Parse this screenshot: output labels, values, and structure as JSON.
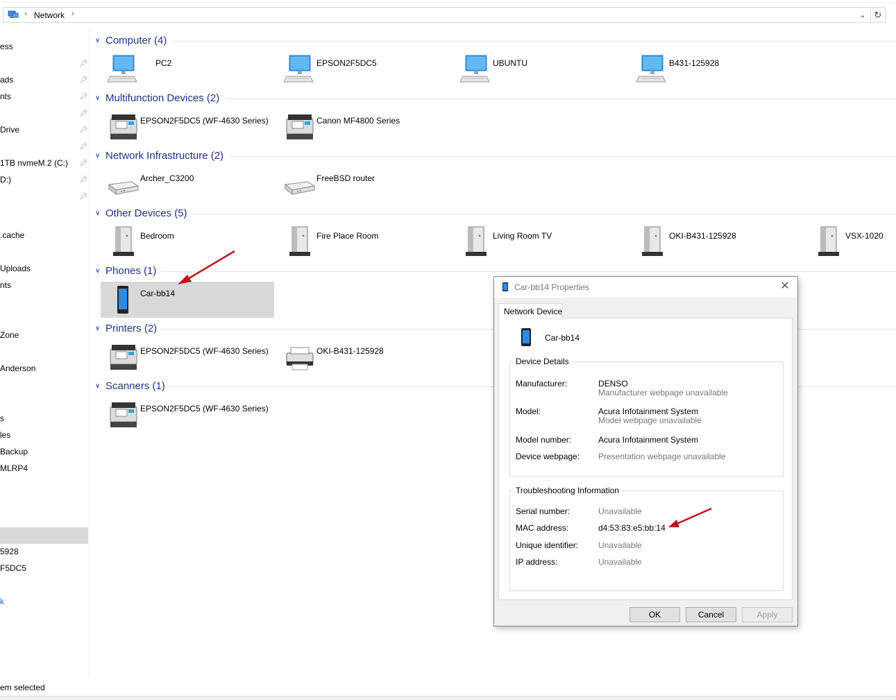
{
  "address_bar": {
    "crumbs": [
      "Network"
    ]
  },
  "nav": {
    "items": [
      {
        "label": "ess"
      },
      {
        "label": "ads"
      },
      {
        "label": "nts"
      },
      {
        "label": "Drive"
      },
      {
        "label": "1TB nvmeM.2 (C:)"
      },
      {
        "label": "D:)"
      },
      {
        "label": ".cache"
      },
      {
        "label": "Uploads"
      },
      {
        "label": "nts"
      },
      {
        "label": "Zone"
      },
      {
        "label": "Anderson"
      },
      {
        "label": "s"
      },
      {
        "label": "les"
      },
      {
        "label": "Backup"
      },
      {
        "label": "MLRP4"
      },
      {
        "label": ""
      },
      {
        "label": "5928"
      },
      {
        "label": "F5DC5"
      },
      {
        "label": "k"
      }
    ]
  },
  "groups": [
    {
      "title": "Computer (4)",
      "items": [
        {
          "label": "PC2",
          "icon": "computer-icon"
        },
        {
          "label": "EPSON2F5DC5",
          "icon": "computer-icon"
        },
        {
          "label": "UBUNTU",
          "icon": "computer-icon"
        },
        {
          "label": "B431-125928",
          "icon": "computer-icon"
        }
      ]
    },
    {
      "title": "Multifunction Devices (2)",
      "items": [
        {
          "label": "EPSON2F5DC5 (WF-4630 Series)",
          "icon": "multifunction-printer-icon"
        },
        {
          "label": "Canon MF4800 Series",
          "icon": "multifunction-printer-icon"
        }
      ]
    },
    {
      "title": "Network Infrastructure (2)",
      "items": [
        {
          "label": "Archer_C3200",
          "icon": "router-icon"
        },
        {
          "label": "FreeBSD router",
          "icon": "router-icon"
        }
      ]
    },
    {
      "title": "Other Devices (5)",
      "items": [
        {
          "label": "Bedroom",
          "icon": "media-device-icon"
        },
        {
          "label": "Fire Place Room",
          "icon": "media-device-icon"
        },
        {
          "label": "Living Room TV",
          "icon": "media-device-icon"
        },
        {
          "label": "OKI-B431-125928",
          "icon": "media-device-icon"
        },
        {
          "label": "VSX-1020",
          "icon": "media-device-icon"
        }
      ]
    },
    {
      "title": "Phones (1)",
      "items": [
        {
          "label": "Car-bb14",
          "icon": "phone-icon",
          "selected": true
        }
      ]
    },
    {
      "title": "Printers (2)",
      "items": [
        {
          "label": "EPSON2F5DC5 (WF-4630 Series)",
          "icon": "multifunction-printer-icon"
        },
        {
          "label": "OKI-B431-125928",
          "icon": "printer-icon"
        }
      ]
    },
    {
      "title": "Scanners (1)",
      "items": [
        {
          "label": "EPSON2F5DC5 (WF-4630 Series)",
          "icon": "multifunction-printer-icon"
        }
      ]
    }
  ],
  "status": {
    "text": "em selected"
  },
  "dialog": {
    "title": "Car-bb14 Properties",
    "tab": "Network Device",
    "device_name": "Car-bb14",
    "device_details": {
      "legend": "Device Details",
      "manufacturer_label": "Manufacturer:",
      "manufacturer_value": "DENSO",
      "manufacturer_sub": "Manufacturer webpage unavailable",
      "model_label": "Model:",
      "model_value": "Acura Infotainment System",
      "model_sub": "Model webpage unavailable",
      "model_number_label": "Model number:",
      "model_number_value": "Acura Infotainment System",
      "webpage_label": "Device webpage:",
      "webpage_value": "Presentation webpage unavailable"
    },
    "troubleshooting": {
      "legend": "Troubleshooting Information",
      "serial_label": "Serial number:",
      "serial_value": "Unavailable",
      "mac_label": "MAC address:",
      "mac_value": "d4:53:83:e5:bb:14",
      "uid_label": "Unique identifier:",
      "uid_value": "Unavailable",
      "ip_label": "IP address:",
      "ip_value": "Unavailable"
    },
    "buttons": {
      "ok": "OK",
      "cancel": "Cancel",
      "apply": "Apply"
    }
  },
  "colors": {
    "group_header": "#1e3287",
    "annotation_arrow": "#c0141c",
    "selection": "#d9d9d9"
  }
}
